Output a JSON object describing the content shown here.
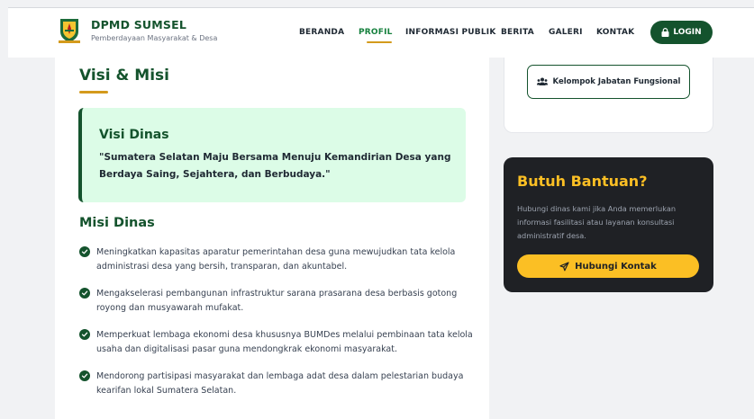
{
  "brand": {
    "title": "DPMD SUMSEL",
    "subtitle": "Pemberdayaan Masyarakat & Desa",
    "logo_icon": "sumsel-emblem"
  },
  "nav": {
    "items": [
      "BERANDA",
      "PROFIL",
      "INFORMASI PUBLIK",
      "BERITA",
      "GALERI",
      "KONTAK"
    ],
    "active": "PROFIL",
    "login_label": "LOGIN",
    "login_icon": "lock-icon"
  },
  "content": {
    "section_title": "Visi & Misi",
    "visi": {
      "title": "Visi Dinas",
      "text": "\"Sumatera Selatan Maju Bersama Menuju Kemandirian Desa yang Berdaya Saing, Sejahtera, dan Berbudaya.\""
    },
    "misi": {
      "title": "Misi Dinas",
      "items": [
        "Meningkatkan kapasitas aparatur pemerintahan desa guna mewujudkan tata kelola administrasi desa yang bersih, transparan, dan akuntabel.",
        "Mengakselerasi pembangunan infrastruktur sarana prasarana desa berbasis gotong royong dan musyawarah mufakat.",
        "Memperkuat lembaga ekonomi desa khususnya BUMDes melalui pembinaan tata kelola usaha dan digitalisasi pasar guna mendongkrak ekonomi masyarakat.",
        "Mendorong partisipasi masyarakat dan lembaga adat desa dalam pelestarian budaya kearifan lokal Sumatera Selatan."
      ]
    }
  },
  "sidebar": {
    "kelompok_label": "Kelompok Jabatan Fungsional",
    "kelompok_icon": "users-icon",
    "help": {
      "title": "Butuh Bantuan?",
      "text": "Hubungi dinas kami jika Anda memerlukan informasi fasilitasi atau layanan konsultasi administratif desa.",
      "button_label": "Hubungi Kontak",
      "button_icon": "send-icon"
    }
  },
  "colors": {
    "primary": "#14532d",
    "accent": "#d49a1c",
    "visi_bg": "#dcfce7",
    "help_bg": "#1f2125",
    "help_accent": "#fbbf24"
  }
}
